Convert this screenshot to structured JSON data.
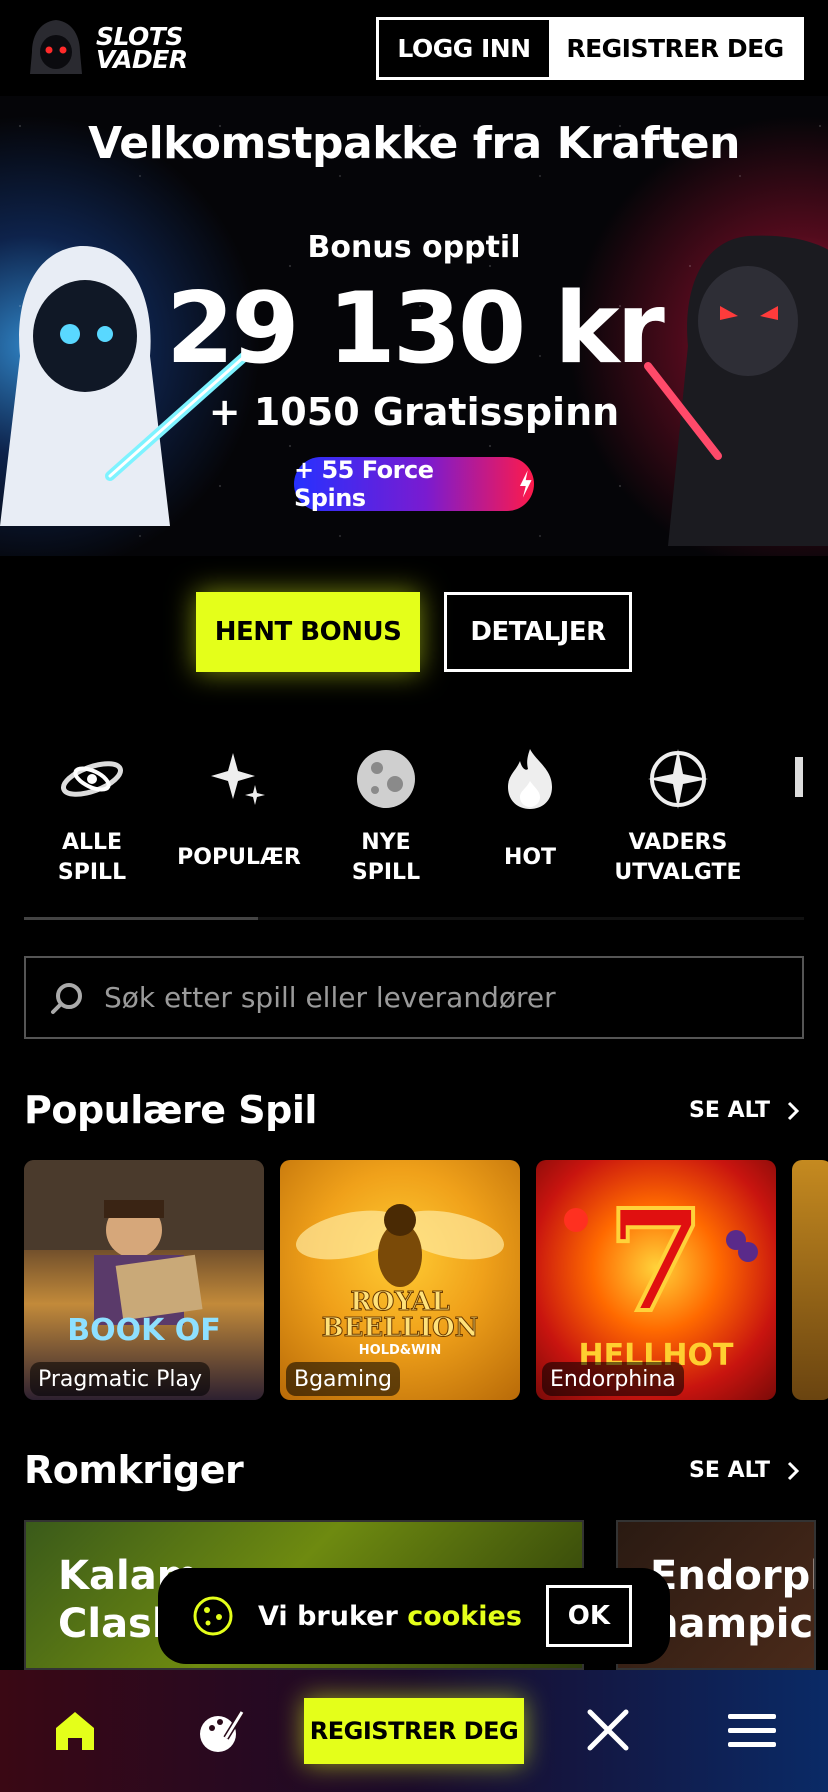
{
  "header": {
    "logo_line1": "SLOTS",
    "logo_line2": "VADER",
    "login_label": "LOGG INN",
    "register_label": "REGISTRER DEG"
  },
  "hero": {
    "title": "Velkomstpakke fra Kraften",
    "subtitle": "Bonus opptil",
    "amount": "29 130 kr",
    "spins": "+ 1050 Gratisspinn",
    "force_spins": "+ 55 Force Spins"
  },
  "cta": {
    "bonus_label": "HENT BONUS",
    "details_label": "DETALJER"
  },
  "categories": [
    {
      "label": "ALLE\nSPILL",
      "icon": "galaxy-icon"
    },
    {
      "label": "POPULÆR",
      "icon": "sparkle-icon"
    },
    {
      "label": "NYE\nSPILL",
      "icon": "moon-icon"
    },
    {
      "label": "HOT",
      "icon": "flame-icon"
    },
    {
      "label": "VADERS\nUTVALGTE",
      "icon": "compass-star-icon"
    }
  ],
  "search": {
    "placeholder": "Søk etter spill eller leverandører"
  },
  "popular": {
    "title": "Populære Spil",
    "see_all": "SE ALT",
    "games": [
      {
        "provider": "Pragmatic Play"
      },
      {
        "provider": "Bgaming"
      },
      {
        "provider": "Endorphina"
      }
    ]
  },
  "romkriger": {
    "title": "Romkriger",
    "see_all": "SE ALT",
    "promos": [
      {
        "title": "Kalam\nClash"
      },
      {
        "title": "Endorph\nhampic"
      }
    ]
  },
  "cookie": {
    "text": "Vi bruker ",
    "link": "cookies",
    "ok_label": "OK"
  },
  "bottom_nav": {
    "register_label": "REGISTRER DEG"
  },
  "colors": {
    "accent": "#e4ff1a",
    "background": "#000000"
  }
}
